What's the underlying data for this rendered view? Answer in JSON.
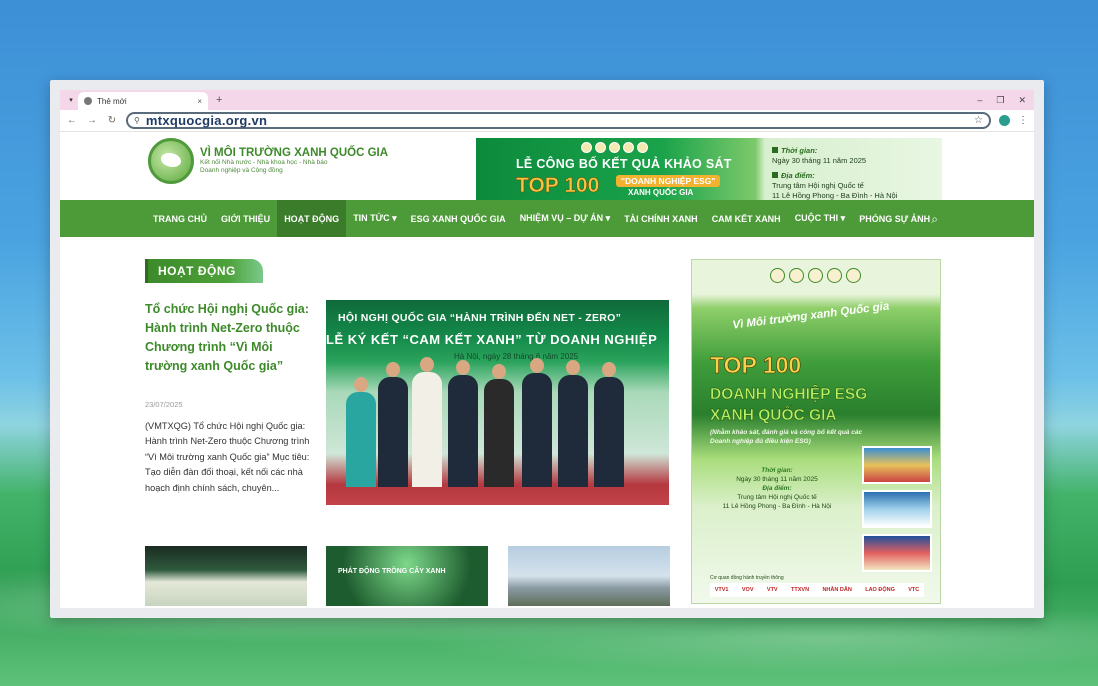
{
  "browser": {
    "tab_title": "Thẻ mới",
    "tab_close": "×",
    "new_tab": "+",
    "url": "mtxquocgia.org.vn",
    "controls": [
      "–",
      "❐",
      "✕"
    ]
  },
  "header": {
    "logo_name": "VÌ MÔI TRƯỜNG XANH QUỐC GIA",
    "logo_tag1": "Kết nối Nhà nước - Nhà khoa học - Nhà báo",
    "logo_tag2": "Doanh nghiệp và Cộng đồng",
    "banner": {
      "line1": "LỄ CÔNG BỐ KẾT QUẢ KHẢO SÁT",
      "line2": "TOP 100",
      "line3": "\"DOANH NGHIỆP ESG\"",
      "line4": "XANH QUỐC GIA",
      "time_label": "Thời gian:",
      "time_value": "Ngày 30 tháng 11 năm 2025",
      "place_label": "Địa điểm:",
      "place_value1": "Trung tâm Hội nghị Quốc tế",
      "place_value2": "11 Lê Hồng Phong - Ba Đình - Hà Nội"
    }
  },
  "nav": {
    "items": [
      {
        "label": "TRANG CHỦ"
      },
      {
        "label": "GIỚI THIỆU"
      },
      {
        "label": "HOẠT ĐỘNG"
      },
      {
        "label": "TIN TỨC ▾"
      },
      {
        "label": "ESG XANH QUỐC GIA"
      },
      {
        "label": "NHIỆM VỤ – DỰ ÁN ▾"
      },
      {
        "label": "TÀI CHÍNH XANH"
      },
      {
        "label": "CAM KẾT XANH"
      },
      {
        "label": "CUỘC THI ▾"
      },
      {
        "label": "PHÓNG SỰ ẢNH"
      }
    ],
    "active_index": 2
  },
  "main": {
    "section_title": "HOẠT ĐỘNG",
    "post": {
      "title": "Tổ chức Hội nghị Quốc gia: Hành trình Net-Zero thuộc Chương trình “Vì Môi trường xanh Quốc gia”",
      "date": "23/07/2025",
      "excerpt": "(VMTXQG) Tổ chức Hội nghị Quốc gia: Hành trình Net-Zero thuộc Chương trình “Vì Môi trường xanh Quốc gia” Mục tiêu: Tạo diễn đàn đối thoại, kết nối các nhà hoạch định chính sách, chuyên..."
    },
    "hero": {
      "line1": "HỘI NGHỊ QUỐC GIA “HÀNH TRÌNH ĐẾN NET - ZERO”",
      "line2": "LỄ KÝ KẾT “CAM KẾT XANH” TỪ DOANH NGHIỆP",
      "line3": "Hà Nội, ngày 28 tháng 6 năm 2025"
    },
    "thumb2_caption": "PHÁT ĐỘNG TRỒNG CÂY XANH"
  },
  "poster": {
    "slogan": "Vì Môi trường xanh Quốc gia",
    "top": "TOP 100",
    "title1": "DOANH NGHIỆP ESG",
    "title2": "XANH QUỐC GIA",
    "desc": "(Nhằm khảo sát, đánh giá và công bố kết quả các Doanh nghiệp đủ điều kiện ESG)",
    "time_label": "Thời gian:",
    "time_value": "Ngày 30 tháng 11 năm 2025",
    "place_label": "Địa điểm:",
    "place_value1": "Trung tâm Hội nghị Quốc tế",
    "place_value2": "11 Lê Hồng Phong - Ba Đình - Hà Nội",
    "media_label": "Cơ quan đồng hành truyền thông",
    "media": [
      "VTV1",
      "VOV",
      "VTV",
      "TTXVN",
      "NHÂN DÂN",
      "LAO ĐỘNG",
      "VTC"
    ]
  },
  "colors": {
    "nav_green": "#4c9a38",
    "nav_active": "#3a7c2a",
    "title_green": "#3d8a2a"
  }
}
